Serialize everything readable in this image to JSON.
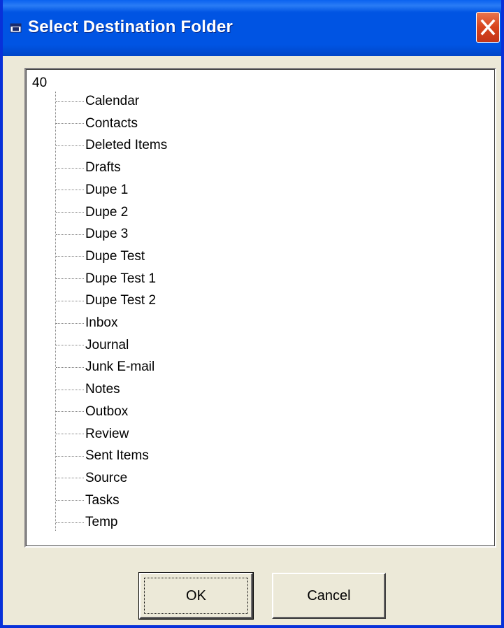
{
  "window": {
    "title": "Select Destination Folder",
    "title_icon": "folder-window-icon",
    "close_icon": "close-icon",
    "accent_color": "#0054e3",
    "close_color": "#d8441c"
  },
  "tree": {
    "root_label": "40",
    "items": [
      "Calendar",
      "Contacts",
      "Deleted Items",
      "Drafts",
      "Dupe 1",
      "Dupe 2",
      "Dupe 3",
      "Dupe Test",
      "Dupe Test 1",
      "Dupe Test 2",
      "Inbox",
      "Journal",
      "Junk E-mail",
      "Notes",
      "Outbox",
      "Review",
      "Sent Items",
      "Source",
      "Tasks",
      "Temp"
    ]
  },
  "buttons": {
    "ok_label": "OK",
    "cancel_label": "Cancel"
  }
}
